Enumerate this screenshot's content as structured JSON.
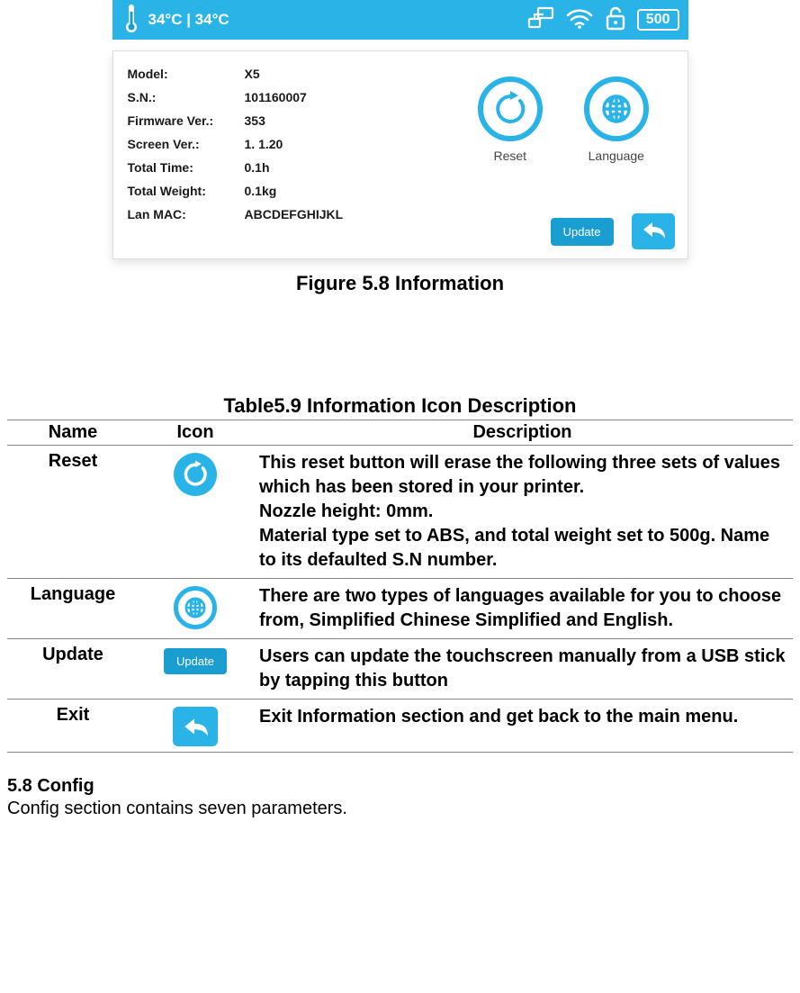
{
  "status": {
    "temp": "34°C | 34°C",
    "count": "500"
  },
  "info": {
    "rows": [
      {
        "k": "Model:",
        "v": "X5"
      },
      {
        "k": "S.N.:",
        "v": "101160007"
      },
      {
        "k": "Firmware Ver.:",
        "v": "353"
      },
      {
        "k": "Screen Ver.:",
        "v": "1. 1.20"
      },
      {
        "k": "Total Time:",
        "v": "0.1h"
      },
      {
        "k": "Total Weight:",
        "v": "0.1kg"
      },
      {
        "k": "Lan MAC:",
        "v": "ABCDEFGHIJKL"
      }
    ],
    "btn_reset": "Reset",
    "btn_language": "Language",
    "btn_update": "Update"
  },
  "caption": "Figure 5.8 Information",
  "table_title": "Table5.9 Information Icon Description",
  "table": {
    "head": {
      "name": "Name",
      "icon": "Icon",
      "desc": "Description"
    },
    "rows": [
      {
        "name": "Reset",
        "icon": "reset-icon",
        "desc": "This reset button will erase the following three sets of values which has been stored in your printer.\nNozzle height: 0mm.\nMaterial type set to ABS, and total weight set to 500g. Name to its defaulted S.N number."
      },
      {
        "name": "Language",
        "icon": "globe-icon",
        "desc": "There are two types of languages available for you to choose from, Simplified Chinese Simplified and English."
      },
      {
        "name": "Update",
        "icon": "update-pill",
        "desc": "Users can update the touchscreen manually from a USB stick by tapping this button",
        "pill": "Update"
      },
      {
        "name": "Exit",
        "icon": "back-square",
        "desc": "Exit Information section and get back to the main menu."
      }
    ]
  },
  "section": {
    "head": "5.8 Config",
    "body": "Config section contains seven parameters."
  }
}
